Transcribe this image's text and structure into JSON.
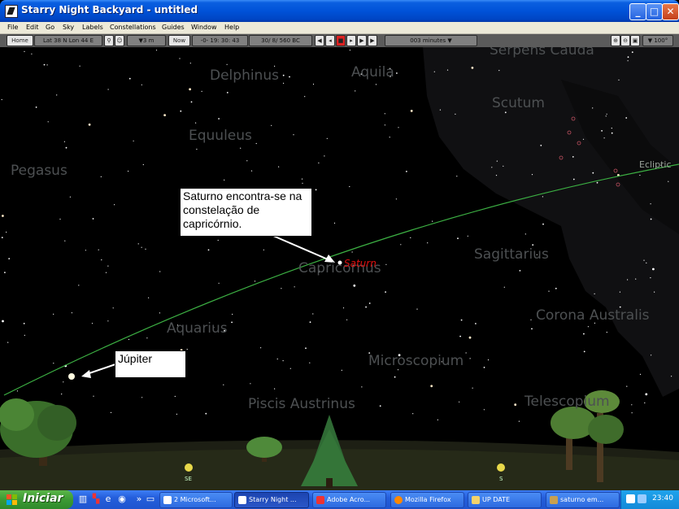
{
  "window": {
    "title": "Starry Night Backyard - untitled"
  },
  "menu": [
    "File",
    "Edit",
    "Go",
    "Sky",
    "Labels",
    "Constellations",
    "Guides",
    "Window",
    "Help"
  ],
  "toolbar": {
    "home_label": "Home",
    "location": "Lat  38 N  Lon  44 E",
    "elevation": "▼3 m",
    "now_label": "Now",
    "time": "-0-  19: 30: 43",
    "date": "30/  8/  560 BC",
    "time_step": "003 minutes ▼",
    "zoom": "▼ 100°"
  },
  "constellations": [
    {
      "name": "Serpens Cauda"
    },
    {
      "name": "Delphinus"
    },
    {
      "name": "Aquila"
    },
    {
      "name": "Scutum"
    },
    {
      "name": "Equuleus"
    },
    {
      "name": "Pegasus"
    },
    {
      "name": "Capricornus"
    },
    {
      "name": "Sagittarius"
    },
    {
      "name": "Corona Australis"
    },
    {
      "name": "Aquarius"
    },
    {
      "name": "Microscopium"
    },
    {
      "name": "Piscis Austrinus"
    },
    {
      "name": "Telescopium"
    }
  ],
  "ecliptic_label": "Ecliptic",
  "planets": [
    {
      "name": "Saturn"
    }
  ],
  "callouts": {
    "saturn": "Saturno encontra-se na constelação de capricórnio.",
    "jupiter": "Júpiter"
  },
  "directions": [
    "SE",
    "S"
  ],
  "taskbar": {
    "start_label": "Iniciar",
    "tasks": [
      "2 Microsoft...",
      "Starry Night ...",
      "Adobe Acro...",
      "Mozilla Firefox",
      "UP DATE",
      "saturno em..."
    ],
    "clock": "23:40"
  },
  "colors": {
    "sky": "#000000",
    "ecliptic": "#3cb043",
    "constellation_label": "#4d5052",
    "planet_label": "#e01010",
    "titlebar": "#0052d8",
    "taskbar": "#245edb",
    "start": "#3c9a34"
  }
}
